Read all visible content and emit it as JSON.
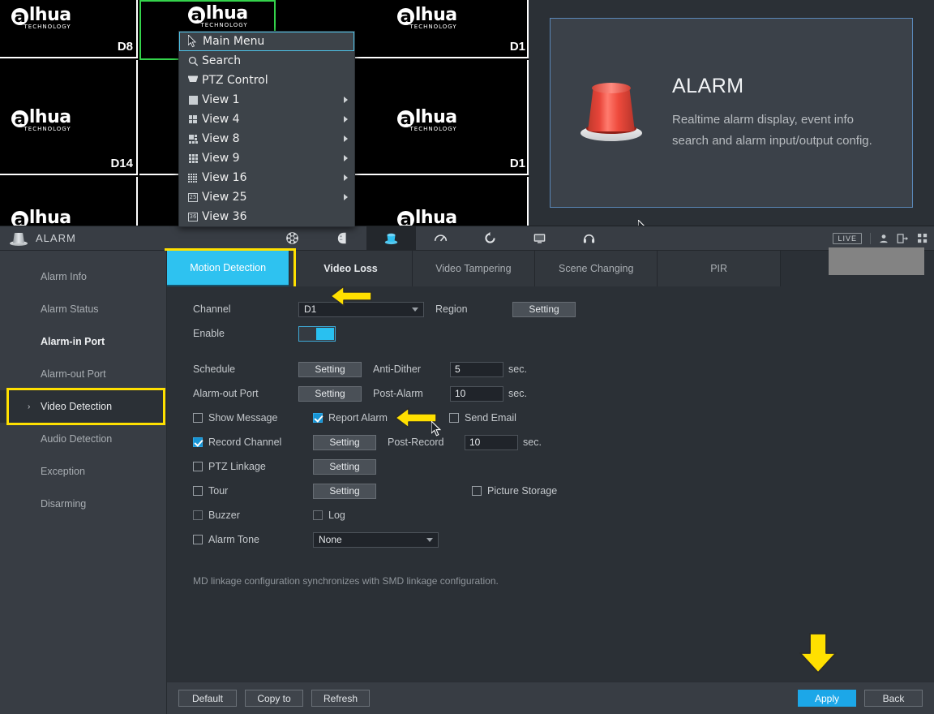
{
  "video_wall": {
    "logo_text": "lhua",
    "logo_sub": "TECHNOLOGY",
    "channels": [
      {
        "label": "D8"
      },
      {
        "label": "D1"
      },
      {
        "label": "D14"
      },
      {
        "label": "D1"
      }
    ]
  },
  "context_menu": {
    "items": [
      {
        "label": "Main Menu",
        "icon": "cursor-icon",
        "submenu": false,
        "active": true
      },
      {
        "label": "Search",
        "icon": "search-icon",
        "submenu": false,
        "active": false
      },
      {
        "label": "PTZ Control",
        "icon": "ptz-dome-icon",
        "submenu": false,
        "active": false
      },
      {
        "label": "View 1",
        "icon": "grid-1-icon",
        "submenu": true,
        "active": false
      },
      {
        "label": "View 4",
        "icon": "grid-4-icon",
        "submenu": true,
        "active": false
      },
      {
        "label": "View 8",
        "icon": "grid-8-icon",
        "submenu": true,
        "active": false
      },
      {
        "label": "View 9",
        "icon": "grid-9-icon",
        "submenu": true,
        "active": false
      },
      {
        "label": "View 16",
        "icon": "grid-16-icon",
        "submenu": true,
        "active": false
      },
      {
        "label": "View 25",
        "icon": "grid-25-icon",
        "submenu": true,
        "active": false
      },
      {
        "label": "View 36",
        "icon": "grid-36-icon",
        "submenu": false,
        "active": false
      }
    ]
  },
  "alarm_card": {
    "title": "ALARM",
    "description": "Realtime alarm display, event info search and alarm input/output config.",
    "icon": "alarm-siren-icon"
  },
  "window": {
    "title": "ALARM",
    "title_icon": "alarm-siren-icon",
    "toolbar_icons": [
      {
        "name": "search-playback-icon",
        "selected": false,
        "glyph": "film"
      },
      {
        "name": "ai-face-icon",
        "selected": false,
        "glyph": "face"
      },
      {
        "name": "alarm-icon",
        "selected": true,
        "glyph": "siren"
      },
      {
        "name": "pos-gauge-icon",
        "selected": false,
        "glyph": "gauge"
      },
      {
        "name": "backup-sync-icon",
        "selected": false,
        "glyph": "sync"
      },
      {
        "name": "display-icon",
        "selected": false,
        "glyph": "monitor"
      },
      {
        "name": "audio-icon",
        "selected": false,
        "glyph": "headset"
      }
    ],
    "header_right": {
      "live_badge": "LIVE",
      "user_icon": "user-icon",
      "logout_icon": "logout-icon",
      "apps_icon": "apps-grid-icon"
    }
  },
  "sidebar": {
    "items": [
      {
        "label": "Alarm Info",
        "selected": false,
        "bold": false,
        "chevron": false
      },
      {
        "label": "Alarm Status",
        "selected": false,
        "bold": false,
        "chevron": false
      },
      {
        "label": "Alarm-in Port",
        "selected": false,
        "bold": true,
        "chevron": false
      },
      {
        "label": "Alarm-out Port",
        "selected": false,
        "bold": false,
        "chevron": false
      },
      {
        "label": "Video Detection",
        "selected": true,
        "bold": false,
        "chevron": true,
        "chevron_glyph": "›",
        "annotated": true
      },
      {
        "label": "Audio Detection",
        "selected": false,
        "bold": false,
        "chevron": false
      },
      {
        "label": "Exception",
        "selected": false,
        "bold": false,
        "chevron": false
      },
      {
        "label": "Disarming",
        "selected": false,
        "bold": false,
        "chevron": false
      }
    ]
  },
  "tabs": {
    "items": [
      {
        "label": "Motion Detection",
        "active": true,
        "annotated": true
      },
      {
        "label": "Video Loss",
        "active": false,
        "strong": true
      },
      {
        "label": "Video Tampering",
        "active": false
      },
      {
        "label": "Scene Changing",
        "active": false
      },
      {
        "label": "PIR",
        "active": false
      }
    ]
  },
  "form": {
    "channel_label": "Channel",
    "channel_value": "D1",
    "region_label": "Region",
    "region_button": "Setting",
    "enable_label": "Enable",
    "enable_on": true,
    "schedule_label": "Schedule",
    "schedule_button": "Setting",
    "anti_dither_label": "Anti-Dither",
    "anti_dither_value": "5",
    "anti_dither_unit": "sec.",
    "alarm_out_label": "Alarm-out Port",
    "alarm_out_button": "Setting",
    "post_alarm_label": "Post-Alarm",
    "post_alarm_value": "10",
    "post_alarm_unit": "sec.",
    "show_message": {
      "label": "Show Message",
      "checked": false
    },
    "report_alarm": {
      "label": "Report Alarm",
      "checked": true
    },
    "send_email": {
      "label": "Send Email",
      "checked": false
    },
    "record_channel": {
      "label": "Record Channel",
      "checked": true
    },
    "record_channel_button": "Setting",
    "post_record_label": "Post-Record",
    "post_record_value": "10",
    "post_record_unit": "sec.",
    "ptz_linkage": {
      "label": "PTZ Linkage",
      "checked": false
    },
    "ptz_linkage_button": "Setting",
    "tour": {
      "label": "Tour",
      "checked": false
    },
    "tour_button": "Setting",
    "picture_storage": {
      "label": "Picture Storage",
      "checked": false
    },
    "buzzer": {
      "label": "Buzzer",
      "checked": false
    },
    "log": {
      "label": "Log",
      "checked": false
    },
    "alarm_tone": {
      "label": "Alarm Tone",
      "checked": false
    },
    "alarm_tone_value": "None",
    "note": "MD linkage configuration synchronizes with SMD linkage configuration."
  },
  "footer": {
    "default_button": "Default",
    "copy_to_button": "Copy to",
    "refresh_button": "Refresh",
    "apply_button": "Apply",
    "back_button": "Back"
  },
  "annotations": {
    "highlight_color": "#ffe000",
    "accent_color": "#2ec2f0",
    "arrows": [
      {
        "name": "enable-toggle-arrow",
        "direction": "left"
      },
      {
        "name": "report-alarm-arrow",
        "direction": "left"
      },
      {
        "name": "apply-button-arrow",
        "direction": "down"
      }
    ]
  }
}
